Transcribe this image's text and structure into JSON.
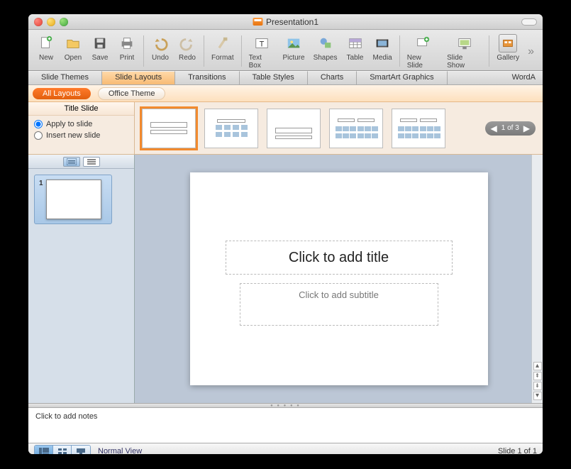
{
  "window": {
    "title": "Presentation1"
  },
  "toolbar": {
    "new": "New",
    "open": "Open",
    "save": "Save",
    "print": "Print",
    "undo": "Undo",
    "redo": "Redo",
    "format": "Format",
    "textbox": "Text Box",
    "picture": "Picture",
    "shapes": "Shapes",
    "table": "Table",
    "media": "Media",
    "newslide": "New Slide",
    "slideshow": "Slide Show",
    "gallery": "Gallery"
  },
  "ribbon": {
    "themes": "Slide Themes",
    "layouts": "Slide Layouts",
    "transitions": "Transitions",
    "tablestyles": "Table Styles",
    "charts": "Charts",
    "smartart": "SmartArt Graphics",
    "wordart": "WordA"
  },
  "layoutbar": {
    "all": "All Layouts",
    "office": "Office Theme"
  },
  "layoutpanel": {
    "title": "Title Slide",
    "apply": "Apply to slide",
    "insert": "Insert new slide",
    "pager": "1 of 3"
  },
  "slide": {
    "title_ph": "Click to add title",
    "subtitle_ph": "Click to add subtitle"
  },
  "thumbs": {
    "num1": "1"
  },
  "notes": {
    "placeholder": "Click to add notes"
  },
  "status": {
    "view": "Normal View",
    "slide": "Slide 1 of 1"
  }
}
